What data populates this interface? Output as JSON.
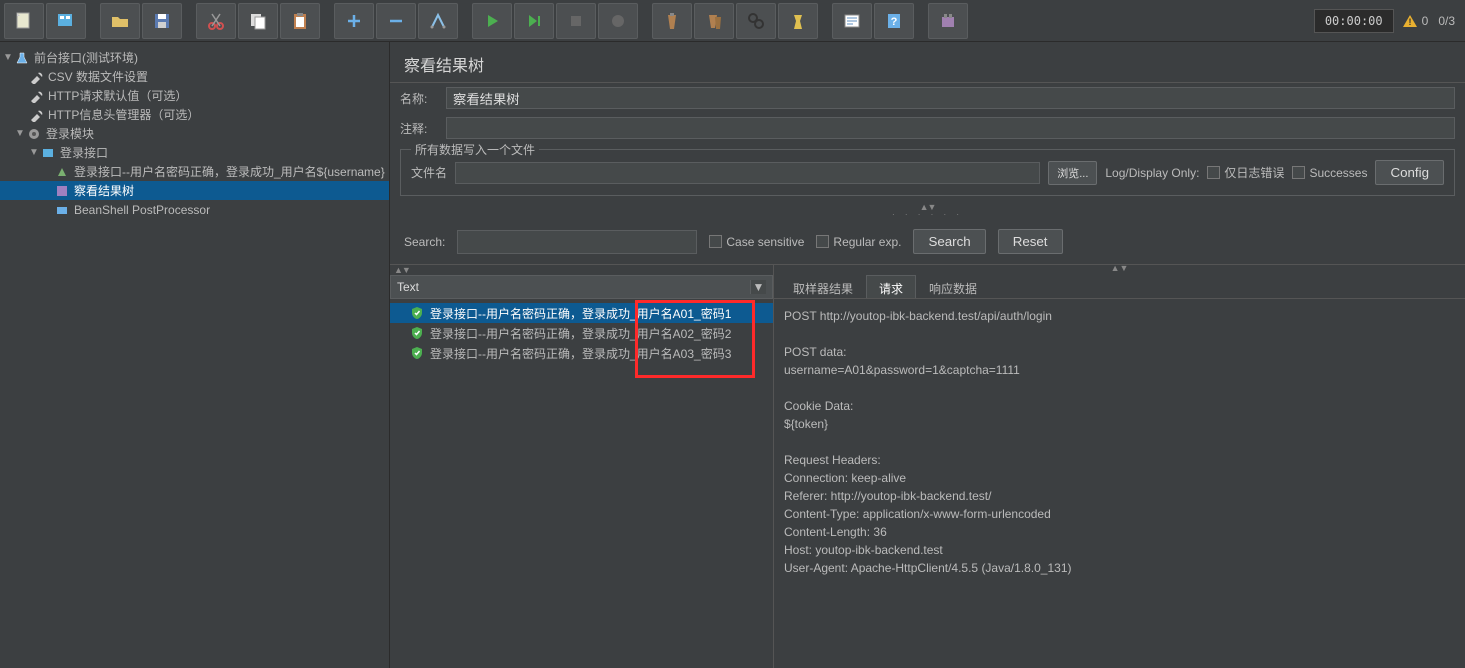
{
  "toolbar": {
    "timer": "00:00:00",
    "warn_count": "0",
    "thread_count": "0/3"
  },
  "tree": {
    "root": "前台接口(测试环境)",
    "csv": "CSV 数据文件设置",
    "http_defaults": "HTTP请求默认值（可选）",
    "http_header": "HTTP信息头管理器（可选）",
    "login_module": "登录模块",
    "login_iface": "登录接口",
    "login_case": "登录接口--用户名密码正确，登录成功_用户名${username}",
    "view_results": "察看结果树",
    "beanshell": "BeanShell PostProcessor"
  },
  "panel": {
    "title": "察看结果树",
    "name_label": "名称:",
    "name_value": "察看结果树",
    "comment_label": "注释:",
    "fieldset_legend": "所有数据写入一个文件",
    "filename_label": "文件名",
    "browse_btn": "浏览...",
    "log_display_only": "Log/Display Only:",
    "errors_only": "仅日志错误",
    "successes": "Successes",
    "configure_btn": "Config",
    "search_label": "Search:",
    "case_sensitive": "Case sensitive",
    "regex": "Regular exp.",
    "search_btn": "Search",
    "reset_btn": "Reset"
  },
  "results": {
    "header": "Text",
    "items": [
      "登录接口--用户名密码正确，登录成功_用户名A01_密码1",
      "登录接口--用户名密码正确，登录成功_用户名A02_密码2",
      "登录接口--用户名密码正确，登录成功_用户名A03_密码3"
    ]
  },
  "tabs": {
    "sampler": "取样器结果",
    "request": "请求",
    "response": "响应数据"
  },
  "request_detail": "POST http://youtop-ibk-backend.test/api/auth/login\n\nPOST data:\nusername=A01&password=1&captcha=1111\n\nCookie Data:\n${token}\n\nRequest Headers:\nConnection: keep-alive\nReferer: http://youtop-ibk-backend.test/\nContent-Type: application/x-www-form-urlencoded\nContent-Length: 36\nHost: youtop-ibk-backend.test\nUser-Agent: Apache-HttpClient/4.5.5 (Java/1.8.0_131)"
}
